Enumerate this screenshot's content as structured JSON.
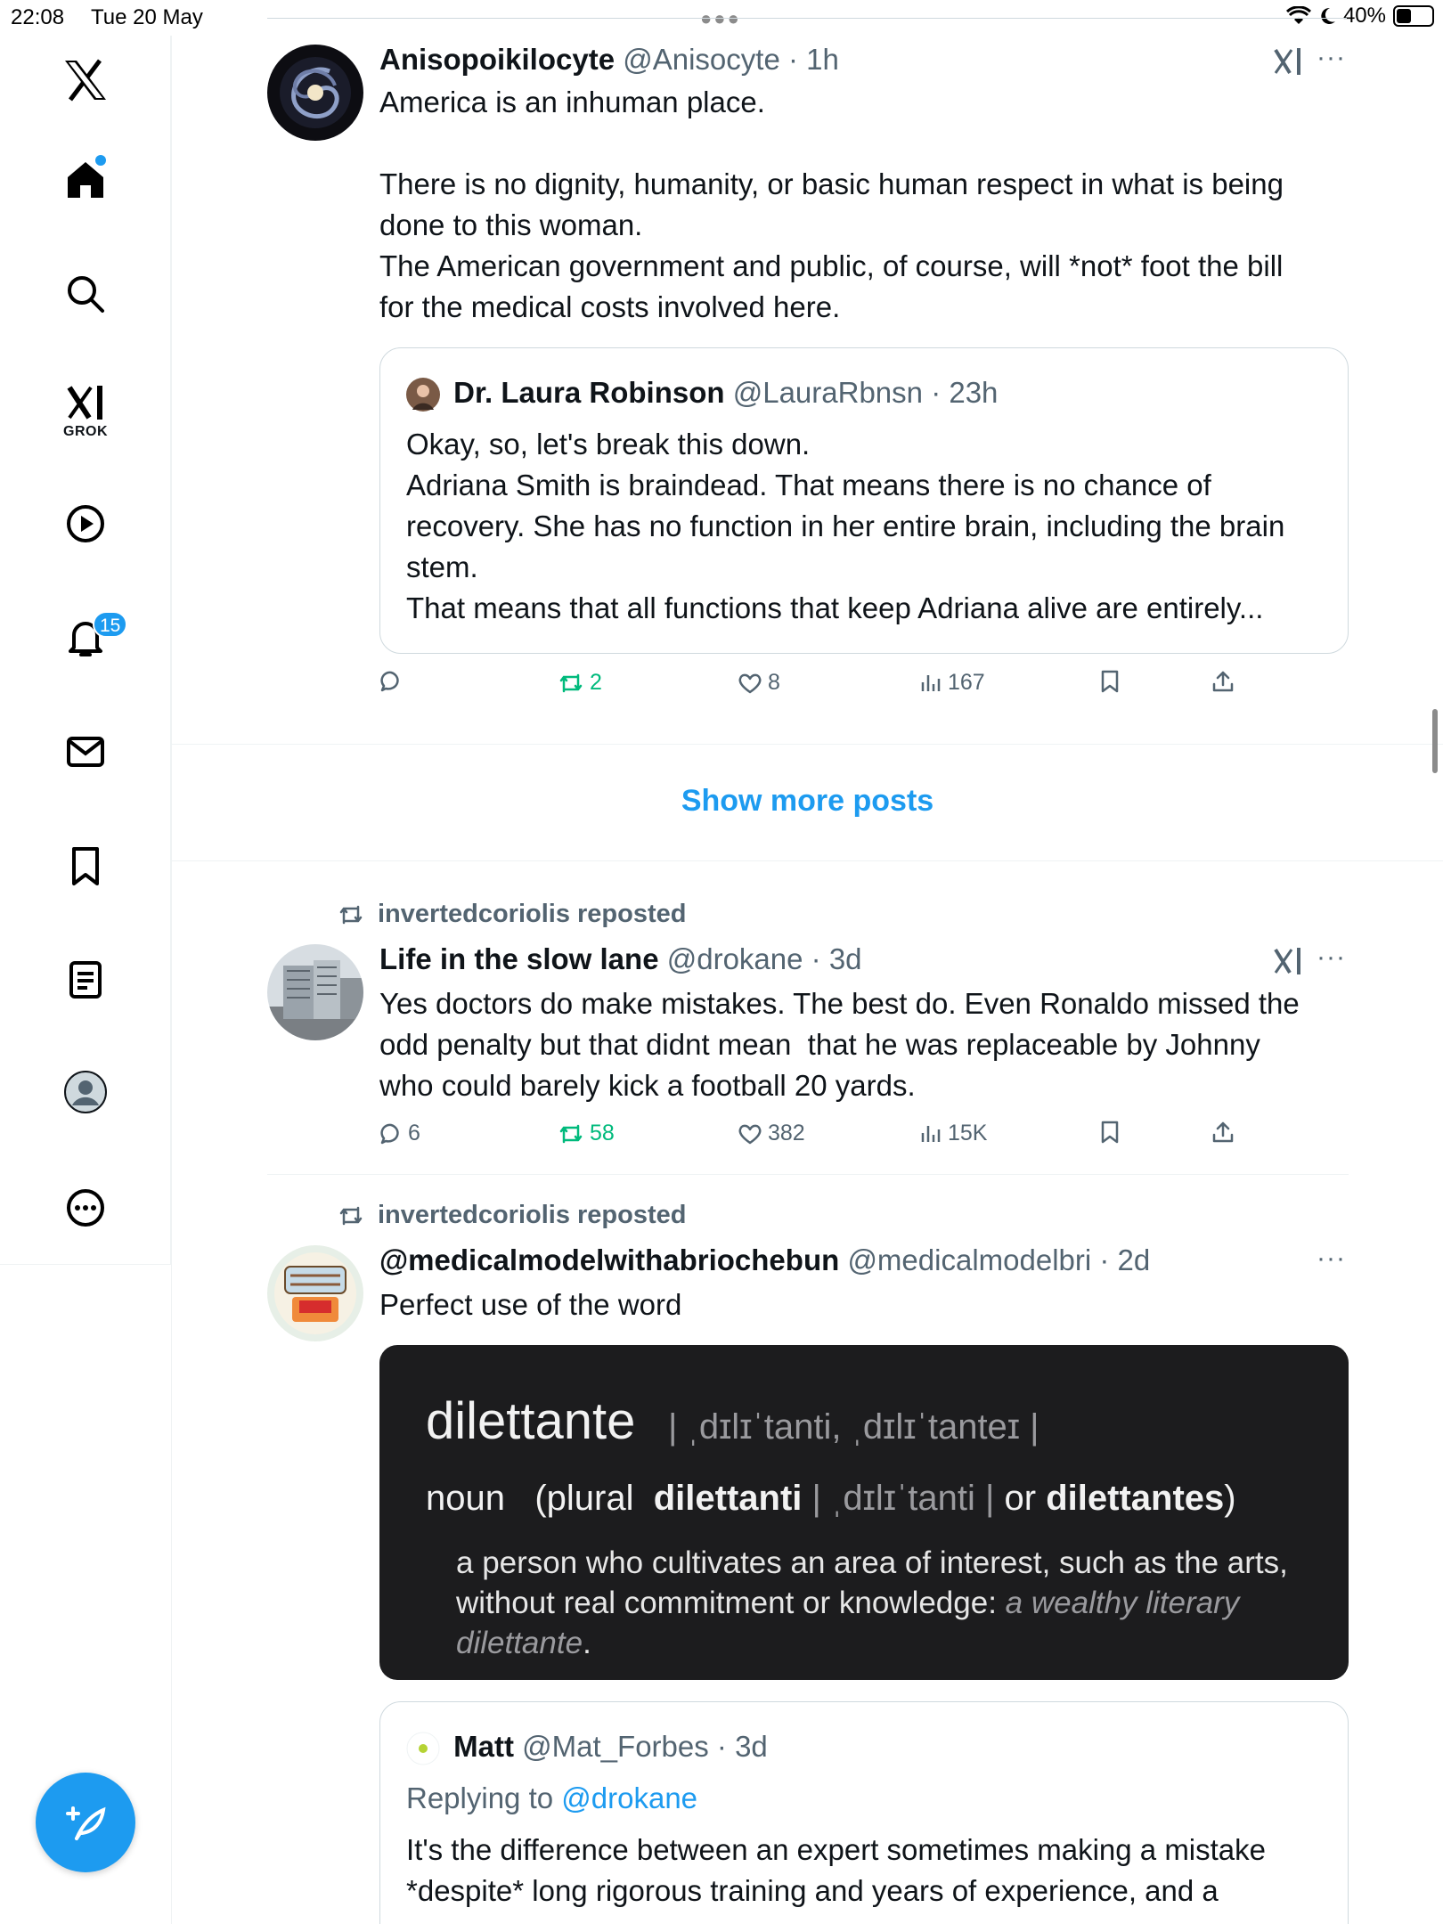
{
  "status_bar": {
    "time": "22:08",
    "date": "Tue 20 May",
    "battery": "40%",
    "battery_level": 0.4
  },
  "sidebar": {
    "badge_count": "15",
    "grok_label": "GROK",
    "items": [
      "x-logo",
      "home",
      "search",
      "grok",
      "video",
      "notifications",
      "messages",
      "bookmarks",
      "lists",
      "profile",
      "more"
    ]
  },
  "tweets": [
    {
      "name": "Anisopoikilocyte",
      "handle": "@Anisocyte",
      "time": "· 1h",
      "text": [
        "America is an inhuman place.",
        "",
        "There is no dignity, humanity, or basic human respect in what is being",
        "done to this woman.",
        "The American government and public, of course, will *not* foot the bill",
        "for the medical costs involved here."
      ],
      "quote": {
        "name": "Dr. Laura Robinson",
        "handle": "@LauraRbnsn",
        "time": "· 23h",
        "text": [
          "Okay, so, let's break this down.",
          "Adriana Smith is braindead. That means there is no chance of",
          "recovery. She has no function in her entire brain, including the brain",
          "stem.",
          "That means that all functions that keep Adriana alive are entirely..."
        ]
      },
      "replies": "",
      "reposts": "2",
      "likes": "8",
      "views": "167"
    },
    {
      "reposted_by": "invertedcoriolis reposted",
      "name": "Life in the slow lane",
      "handle": "@drokane",
      "time": "· 3d",
      "text": [
        "Yes doctors do make mistakes. The best do. Even Ronaldo missed the",
        "odd penalty but that didnt mean  that he was replaceable by Johnny",
        "who could barely kick a football 20 yards."
      ],
      "replies": "6",
      "reposts": "58",
      "likes": "382",
      "views": "15K"
    },
    {
      "reposted_by": "invertedcoriolis reposted",
      "name": "@medicalmodelwithabriochebun",
      "handle": "@medicalmodelbri",
      "time": "· 2d",
      "text": [
        "Perfect use of the word"
      ],
      "dictionary": {
        "word": "dilettante",
        "pronunciation": "| ˌdɪlɪˈtanti, ˌdɪlɪˈtanteɪ |",
        "pos": "noun",
        "plural_open": "(plural",
        "plural1": "dilettanti",
        "plural1_pron": "| ˌdɪlɪˈtanti |",
        "or": "or",
        "plural2": "dilettantes",
        "close": ")",
        "definition": "a person who cultivates an area of interest, such as the arts, without real commitment or knowledge:",
        "example": "a wealthy literary dilettante",
        "example_end": "."
      },
      "quote": {
        "name": "Matt",
        "handle": "@Mat_Forbes",
        "time": "· 3d",
        "replying_to_prefix": "Replying to",
        "replying_to": "@drokane",
        "text": [
          "It's the difference between an expert sometimes making a mistake",
          "*despite* long rigorous training and years of experience, and a"
        ]
      }
    }
  ],
  "show_more": "Show more posts",
  "colors": {
    "accent": "#1d9bf0",
    "repost_green": "#00ba7c",
    "secondary_text": "#536471"
  }
}
